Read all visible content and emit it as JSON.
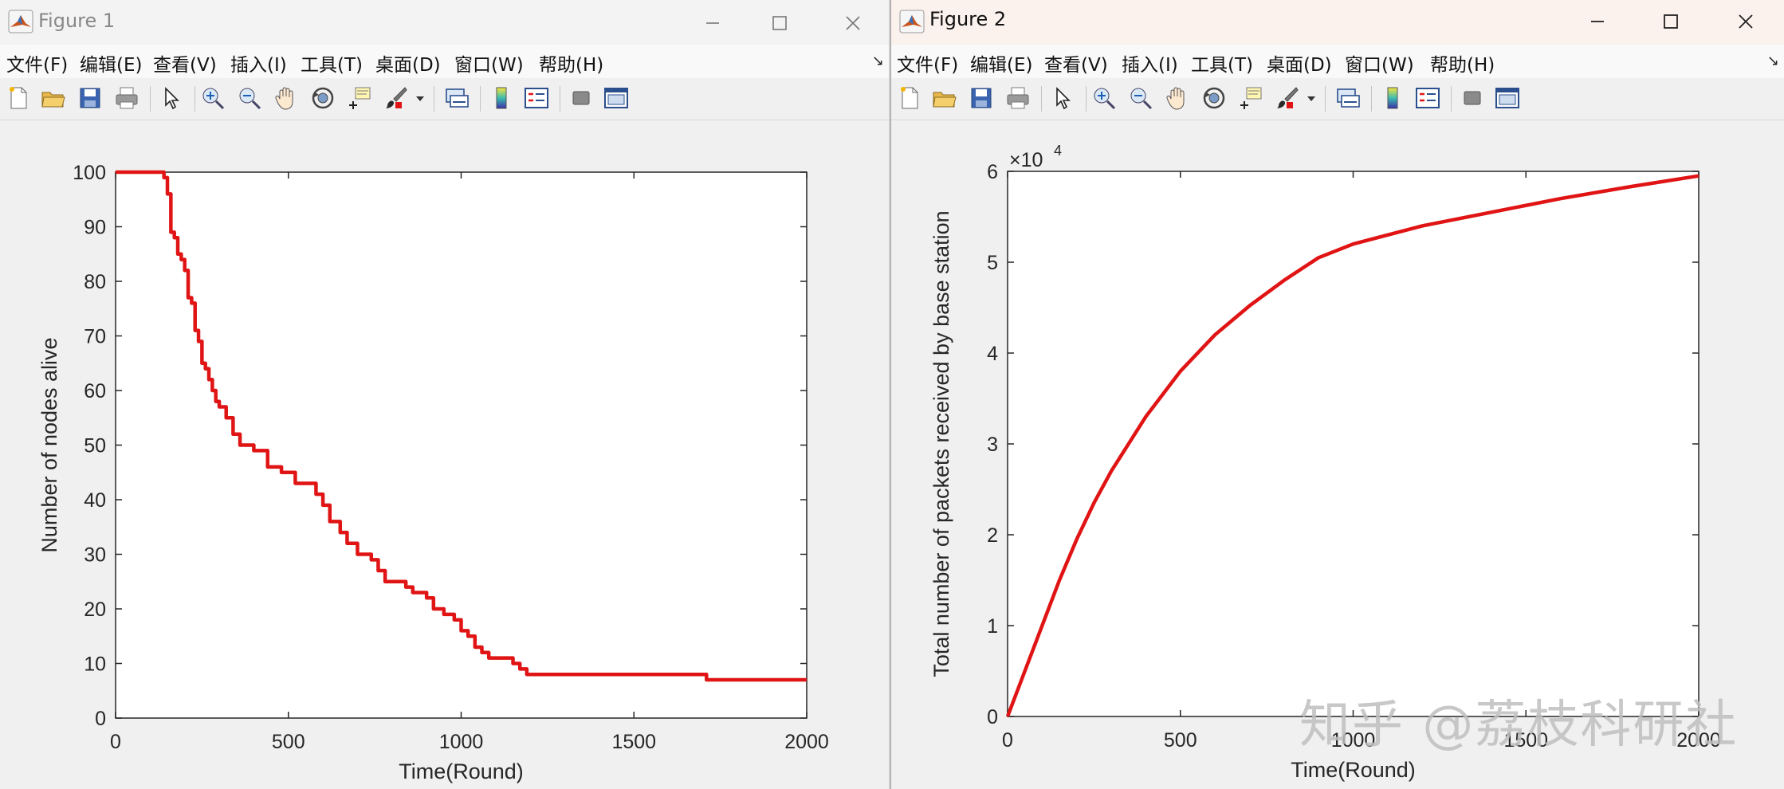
{
  "windows": [
    {
      "title": "Figure 1",
      "menus": [
        "文件(F)",
        "编辑(E)",
        "查看(V)",
        "插入(I)",
        "工具(T)",
        "桌面(D)",
        "窗口(W)",
        "帮助(H)"
      ],
      "chart_data": {
        "type": "line",
        "xlabel": "Time(Round)",
        "ylabel": "Number of nodes alive",
        "xlim": [
          0,
          2000
        ],
        "ylim": [
          0,
          100
        ],
        "xticks": [
          "0",
          "500",
          "1000",
          "1500",
          "2000"
        ],
        "yticks": [
          "0",
          "10",
          "20",
          "30",
          "40",
          "50",
          "60",
          "70",
          "80",
          "90",
          "100"
        ],
        "grid": false,
        "series": [
          {
            "color": "#e01414",
            "x": [
              0,
              130,
              140,
              150,
              160,
              170,
              180,
              190,
              200,
              210,
              220,
              230,
              240,
              250,
              260,
              270,
              280,
              290,
              300,
              320,
              340,
              360,
              400,
              440,
              480,
              520,
              550,
              580,
              600,
              620,
              650,
              670,
              700,
              740,
              760,
              780,
              840,
              860,
              900,
              920,
              950,
              980,
              1000,
              1020,
              1040,
              1060,
              1080,
              1100,
              1150,
              1170,
              1190,
              1200,
              1400,
              1700,
              1710,
              2000
            ],
            "y": [
              100,
              100,
              99,
              96,
              89,
              88,
              85,
              84,
              82,
              77,
              76,
              71,
              69,
              65,
              64,
              62,
              60,
              58,
              57,
              55,
              52,
              50,
              49,
              46,
              45,
              43,
              43,
              41,
              39,
              36,
              34,
              32,
              30,
              29,
              27,
              25,
              24,
              23,
              22,
              20,
              19,
              18,
              16,
              15,
              13,
              12,
              11,
              11,
              10,
              9,
              8,
              8,
              8,
              8,
              7,
              7
            ]
          }
        ]
      }
    },
    {
      "title": "Figure 2",
      "menus": [
        "文件(F)",
        "编辑(E)",
        "查看(V)",
        "插入(I)",
        "工具(T)",
        "桌面(D)",
        "窗口(W)",
        "帮助(H)"
      ],
      "chart_data": {
        "type": "line",
        "xlabel": "Time(Round)",
        "ylabel": "Total number of packets received by base station",
        "exponent_prefix": "×10",
        "exponent": "4",
        "xlim": [
          0,
          2000
        ],
        "ylim": [
          0,
          6
        ],
        "xticks": [
          "0",
          "500",
          "1000",
          "1500",
          "2000"
        ],
        "yticks": [
          "0",
          "1",
          "2",
          "3",
          "4",
          "5",
          "6"
        ],
        "grid": false,
        "series": [
          {
            "color": "#e01414",
            "x": [
              0,
              50,
              100,
              150,
              200,
              250,
              300,
              400,
              500,
              600,
              700,
              800,
              900,
              1000,
              1100,
              1200,
              1400,
              1600,
              1800,
              2000
            ],
            "y": [
              0,
              0.5,
              1.0,
              1.5,
              1.95,
              2.35,
              2.7,
              3.3,
              3.8,
              4.2,
              4.52,
              4.8,
              5.05,
              5.2,
              5.3,
              5.4,
              5.55,
              5.7,
              5.83,
              5.95
            ]
          }
        ]
      }
    }
  ],
  "watermark": "知乎 @荔枝科研社"
}
